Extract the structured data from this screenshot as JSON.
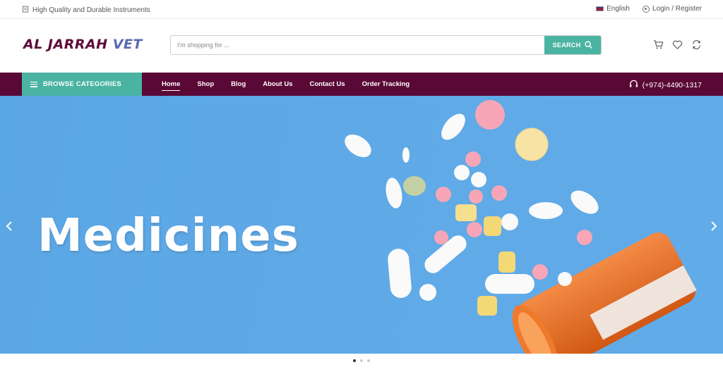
{
  "topbar": {
    "tagline": "High Quality and Durable Instruments",
    "language": "English",
    "account": "Login / Register"
  },
  "header": {
    "logo_part1": "AL JARRAH ",
    "logo_part2": "VET",
    "search_placeholder": "I'm shopping for ...",
    "search_button": "SEARCH",
    "icons": [
      "cart-icon",
      "heart-icon",
      "compare-icon"
    ]
  },
  "nav": {
    "browse_label": "BROWSE CATEGORIES",
    "links": [
      "Home",
      "Shop",
      "Blog",
      "About Us",
      "Contact Us",
      "Order Tracking"
    ],
    "active": "Home",
    "phone": "(+974)-4490-1317"
  },
  "hero": {
    "title": "Medicines",
    "slides": 3,
    "active_slide": 1
  },
  "colors": {
    "primary": "#5a0836",
    "accent": "#4ab3a1",
    "hero_bg": "#5ea8e6",
    "pill_bottle": "#e8651a"
  }
}
